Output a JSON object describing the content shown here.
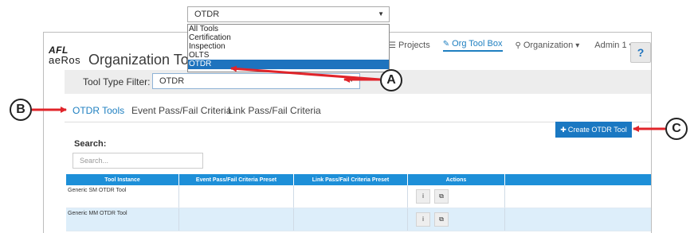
{
  "logo": {
    "brand": "AFL",
    "product": "aeRos"
  },
  "page_title": "Organization Tools",
  "topnav": {
    "projects": "Projects",
    "org_tool_box": "Org Tool Box",
    "organization": "Organization",
    "user": "Admin 1"
  },
  "help_label": "?",
  "filter": {
    "label": "Tool Type Filter:",
    "value": "OTDR"
  },
  "dropdown": {
    "value": "OTDR",
    "options": [
      "All Tools",
      "Certification",
      "Inspection",
      "OLTS",
      "OTDR"
    ],
    "selected_index": 4
  },
  "tabs": [
    {
      "label": "OTDR Tools",
      "active": true
    },
    {
      "label": "Event Pass/Fail Criteria",
      "active": false
    },
    {
      "label": "Link Pass/Fail Criteria",
      "active": false
    }
  ],
  "create_button": "Create OTDR Tool",
  "search": {
    "label": "Search:",
    "placeholder": "Search..."
  },
  "table": {
    "columns": [
      "Tool Instance",
      "Event Pass/Fail Criteria Preset",
      "Link Pass/Fail Criteria Preset",
      "Actions",
      ""
    ],
    "rows": [
      {
        "tool_instance": "Generic SM OTDR Tool",
        "event_preset": "",
        "link_preset": ""
      },
      {
        "tool_instance": "Generic MM OTDR Tool",
        "event_preset": "",
        "link_preset": ""
      }
    ],
    "action_info": "i",
    "action_copy": "⧉"
  },
  "callouts": {
    "a": "A",
    "b": "B",
    "c": "C"
  },
  "colors": {
    "accent": "#1e7fc0",
    "header": "#1d8fd8",
    "arrow": "#e0242a"
  }
}
